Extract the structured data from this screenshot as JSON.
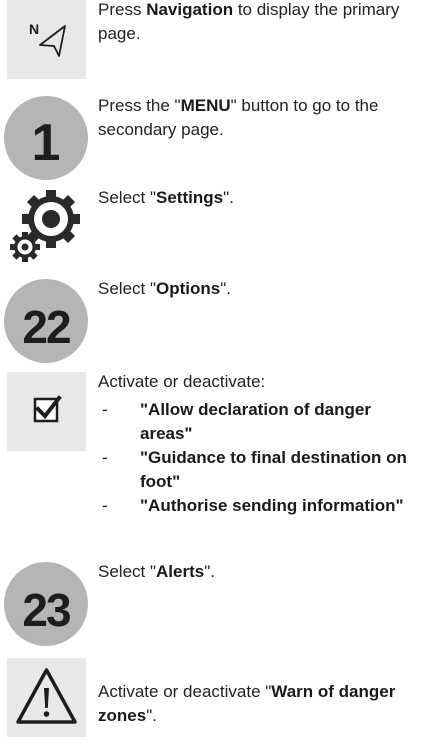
{
  "steps": [
    {
      "icon": "navigation-arrow-icon",
      "icon_label": "N",
      "parts": [
        {
          "t": "Press ",
          "b": false
        },
        {
          "t": "Navigation",
          "b": true
        },
        {
          "t": " to display the primary page.",
          "b": false
        }
      ]
    },
    {
      "icon": "number-badge",
      "badge": "1",
      "parts": [
        {
          "t": "Press the \"",
          "b": false
        },
        {
          "t": "MENU",
          "b": true
        },
        {
          "t": "\" button to go to the secondary page.",
          "b": false
        }
      ]
    },
    {
      "icon": "settings-gears-icon",
      "parts": [
        {
          "t": "Select \"",
          "b": false
        },
        {
          "t": "Settings",
          "b": true
        },
        {
          "t": "\".",
          "b": false
        }
      ]
    },
    {
      "icon": "number-badge",
      "badge": "22",
      "parts": [
        {
          "t": "Select \"",
          "b": false
        },
        {
          "t": "Options",
          "b": true
        },
        {
          "t": "\".",
          "b": false
        }
      ]
    },
    {
      "icon": "checkbox-icon",
      "intro": "Activate or deactivate:",
      "bullet": "-",
      "options": [
        "\"Allow declaration of danger areas\"",
        "\"Guidance to final destination on foot\"",
        "\"Authorise sending information\""
      ]
    },
    {
      "icon": "number-badge",
      "badge": "23",
      "parts": [
        {
          "t": "Select \"",
          "b": false
        },
        {
          "t": "Alerts",
          "b": true
        },
        {
          "t": "\".",
          "b": false
        }
      ]
    },
    {
      "icon": "warning-triangle-icon",
      "parts": [
        {
          "t": "Activate or deactivate \"",
          "b": false
        },
        {
          "t": "Warn of danger zones",
          "b": true
        },
        {
          "t": "\".",
          "b": false
        }
      ]
    }
  ]
}
